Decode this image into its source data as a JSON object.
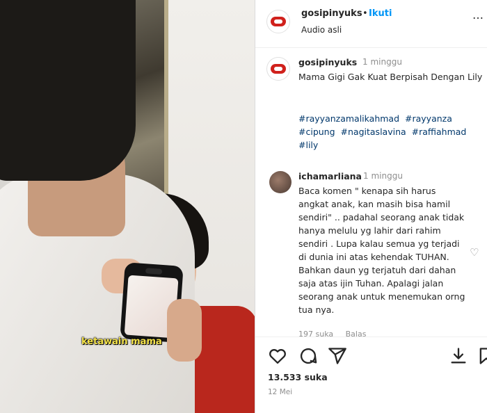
{
  "video": {
    "caption_overlay": "ketawain mama"
  },
  "header": {
    "username": "gosipinyuks",
    "separator": "•",
    "follow_label": "Ikuti",
    "audio_label": "Audio asli",
    "more_label": "…",
    "avatar_icon": "gosipinyuks-logo-icon"
  },
  "caption": {
    "username": "gosipinyuks",
    "time": "1 minggu",
    "text": "Mama Gigi Gak Kuat Berpisah Dengan Lily",
    "hashtags": [
      "#rayyanzamalikahmad",
      "#rayyanza",
      "#cipung",
      "#nagitaslavina",
      "#raffiahmad",
      "#lily"
    ]
  },
  "comment": {
    "username": "ichamarliana",
    "time": "1 minggu",
    "text": "Baca komen \" kenapa sih harus angkat anak, kan masih bisa hamil sendiri\" .. padahal seorang anak tidak hanya melulu yg lahir dari rahim sendiri . Lupa kalau semua yg terjadi di dunia ini atas kehendak TUHAN. Bahkan daun yg terjatuh dari dahan saja atas ijin Tuhan. Apalagi jalan seorang anak untuk menemukan orng tua nya.",
    "likes": "197 suka",
    "reply_label": "Balas"
  },
  "actions": {
    "icons": [
      "heart-icon",
      "comment-icon",
      "share-icon",
      "download-icon",
      "bookmark-icon"
    ]
  },
  "likes_text": "13.533 suka",
  "date_text": "12 Mei",
  "colors": {
    "link": "#0095f6",
    "hashtag": "#00376b",
    "brand": "#d0211c"
  }
}
